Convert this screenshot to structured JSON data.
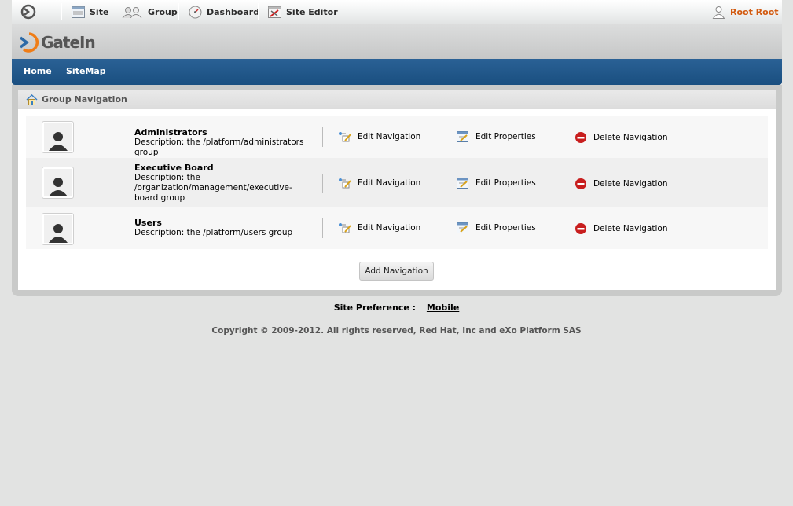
{
  "toolbar": {
    "site_label": "Site",
    "group_label": "Group",
    "dashboard_label": "Dashboard",
    "site_editor_label": "Site Editor",
    "user_name": "Root Root"
  },
  "banner": {
    "logo_text_a": "Gate",
    "logo_text_b": "In"
  },
  "nav": {
    "home": "Home",
    "sitemap": "SiteMap"
  },
  "panel": {
    "title": "Group Navigation",
    "groups": [
      {
        "name": "Administrators",
        "description": "Description: the /platform/administrators group"
      },
      {
        "name": "Executive Board",
        "description": "Description: the /organization/management/executive-board group"
      },
      {
        "name": "Users",
        "description": "Description: the /platform/users group"
      }
    ],
    "actions": {
      "edit_navigation": "Edit Navigation",
      "edit_properties": "Edit Properties",
      "delete_navigation": "Delete Navigation"
    },
    "add_button": "Add Navigation"
  },
  "footer": {
    "site_preference_label": "Site Preference :",
    "mobile_link": "Mobile",
    "copyright": "Copyright © 2009-2012. All rights reserved, Red Hat, Inc and eXo Platform SAS"
  },
  "colors": {
    "nav_blue": "#1f5688",
    "user_orange": "#d25a10",
    "delete_red": "#c81e1e"
  }
}
